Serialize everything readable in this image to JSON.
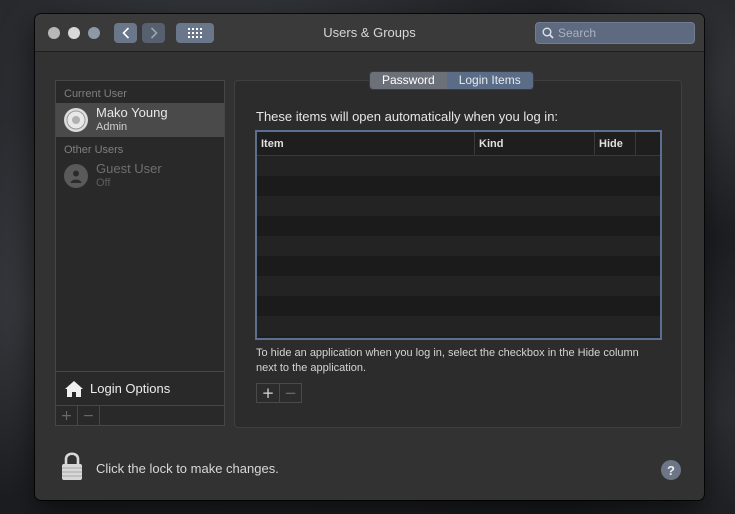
{
  "window": {
    "title": "Users & Groups",
    "search_placeholder": "Search"
  },
  "sidebar": {
    "current_user_header": "Current User",
    "other_users_header": "Other Users",
    "users": [
      {
        "name": "Mako Young",
        "role": "Admin",
        "selected": true
      },
      {
        "name": "Guest User",
        "role": "Off",
        "selected": false
      }
    ],
    "login_options_label": "Login Options",
    "add_label": "+",
    "remove_label": "−"
  },
  "tabs": [
    {
      "label": "Password",
      "active": true
    },
    {
      "label": "Login Items",
      "active": false
    }
  ],
  "login_items": {
    "heading": "These items will open automatically when you log in:",
    "columns": [
      "Item",
      "Kind",
      "Hide"
    ],
    "rows": [],
    "hint": "To hide an application when you log in, select the checkbox in the Hide column next to the application.",
    "add_label": "+",
    "remove_label": "−"
  },
  "footer": {
    "lock_text": "Click the lock to make changes.",
    "help_label": "?"
  },
  "colors": {
    "accent": "#5b6f8e",
    "window_bg": "#323232",
    "sidebar_selected": "#4a4a4a"
  }
}
